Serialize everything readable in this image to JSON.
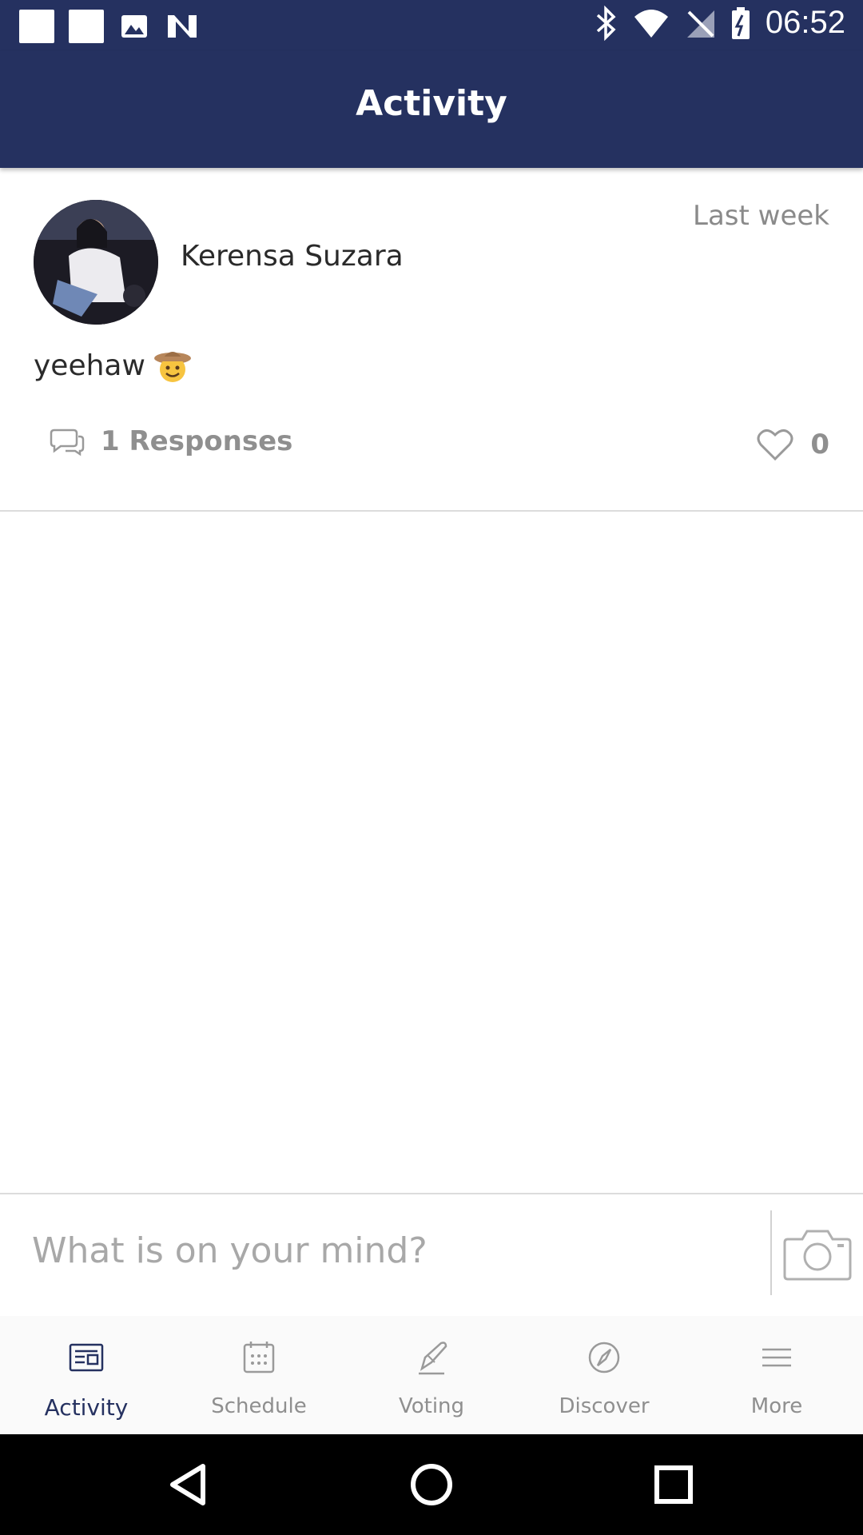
{
  "status_bar": {
    "time": "06:52",
    "left_icons": [
      "notification-square-icon",
      "notification-square-icon",
      "image-icon",
      "n-app-icon"
    ],
    "right_icons": [
      "bluetooth-icon",
      "wifi-icon",
      "no-signal-icon",
      "battery-icon"
    ]
  },
  "appbar": {
    "title": "Activity"
  },
  "post": {
    "author": "Kerensa Suzara",
    "time": "Last week",
    "text": "yeehaw",
    "emoji": "cowboy-face-emoji",
    "responses_label": "1 Responses",
    "likes": "0"
  },
  "compose": {
    "placeholder": "What is on your mind?"
  },
  "bottom_nav": {
    "items": [
      {
        "label": "Activity",
        "icon": "newspaper-icon",
        "active": true
      },
      {
        "label": "Schedule",
        "icon": "calendar-icon",
        "active": false
      },
      {
        "label": "Voting",
        "icon": "voting-pen-icon",
        "active": false
      },
      {
        "label": "Discover",
        "icon": "compass-icon",
        "active": false
      },
      {
        "label": "More",
        "icon": "menu-icon",
        "active": false
      }
    ]
  },
  "colors": {
    "primary": "#253160",
    "muted_text": "#8f8f8f",
    "divider": "#dcdcdc"
  }
}
